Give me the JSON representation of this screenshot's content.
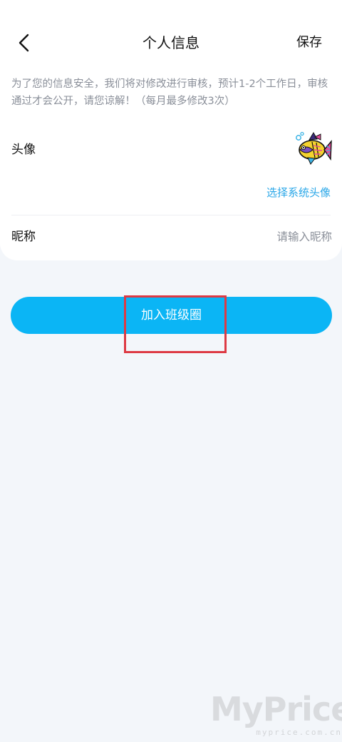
{
  "header": {
    "title": "个人信息",
    "save_label": "保存",
    "back_icon": "chevron-left-icon"
  },
  "notice": "为了您的信息安全，我们将对修改进行审核，预计1-2个工作日，审核通过才会公开，请您谅解！（每月最多修改3次）",
  "avatar_section": {
    "label": "头像",
    "choose_link": "选择系统头像",
    "avatar_icon": "fish-avatar-icon"
  },
  "nickname_section": {
    "label": "昵称",
    "value": "",
    "placeholder": "请输入昵称"
  },
  "join_button": {
    "label": "加入班级圈"
  },
  "watermark": {
    "main": "MyPrice",
    "sub": "myprice.com.cn"
  },
  "colors": {
    "accent": "#0bb5f5",
    "link": "#2aa7e8",
    "highlight_box": "#dd3a44",
    "background": "#f3f6fa"
  }
}
